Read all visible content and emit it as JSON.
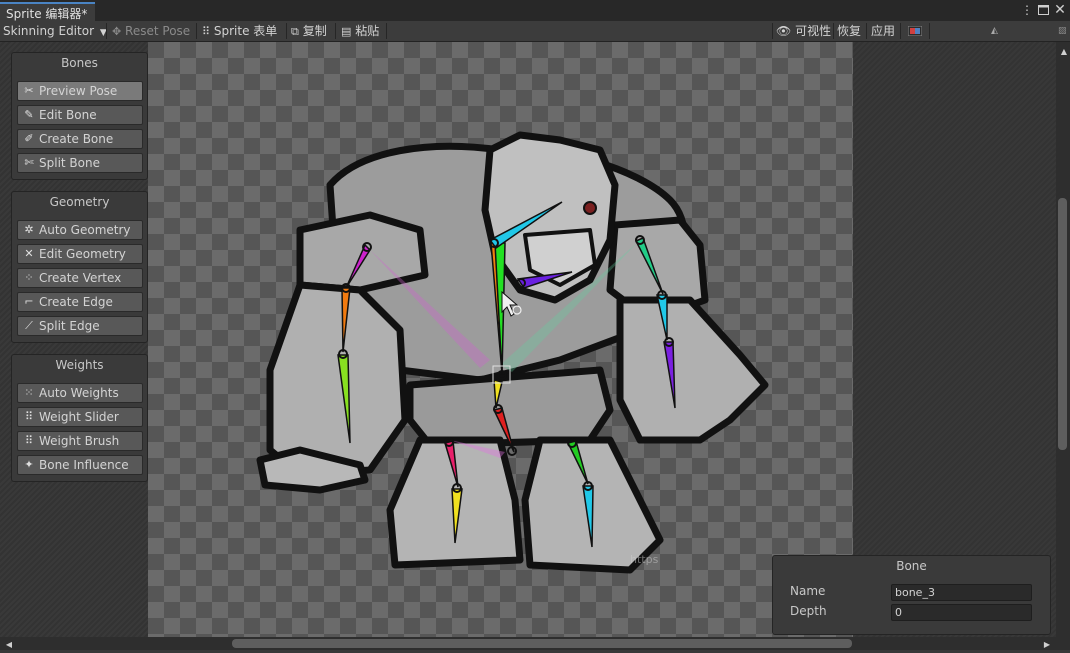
{
  "window": {
    "tab_title": "Sprite 编辑器*"
  },
  "toolbar": {
    "mode": "Skinning Editor",
    "reset_pose": "Reset Pose",
    "sprite_sheet": "Sprite 表单",
    "copy": "复制",
    "paste": "粘贴",
    "visibility": "可视性",
    "revert": "恢复",
    "apply": "应用"
  },
  "bones_panel": {
    "title": "Bones",
    "buttons": [
      {
        "label": "Preview Pose",
        "icon": "preview-pose-icon",
        "active": true
      },
      {
        "label": "Edit Bone",
        "icon": "edit-bone-icon"
      },
      {
        "label": "Create Bone",
        "icon": "create-bone-icon"
      },
      {
        "label": "Split Bone",
        "icon": "split-bone-icon"
      }
    ]
  },
  "geometry_panel": {
    "title": "Geometry",
    "buttons": [
      {
        "label": "Auto Geometry",
        "icon": "auto-geometry-icon"
      },
      {
        "label": "Edit Geometry",
        "icon": "edit-geometry-icon"
      },
      {
        "label": "Create Vertex",
        "icon": "create-vertex-icon"
      },
      {
        "label": "Create Edge",
        "icon": "create-edge-icon"
      },
      {
        "label": "Split Edge",
        "icon": "split-edge-icon"
      }
    ]
  },
  "weights_panel": {
    "title": "Weights",
    "buttons": [
      {
        "label": "Auto Weights",
        "icon": "auto-weights-icon"
      },
      {
        "label": "Weight Slider",
        "icon": "weight-slider-icon"
      },
      {
        "label": "Weight Brush",
        "icon": "weight-brush-icon"
      },
      {
        "label": "Bone Influence",
        "icon": "bone-influence-icon"
      }
    ]
  },
  "bone_inspector": {
    "title": "Bone",
    "name_label": "Name",
    "name_value": "bone_3",
    "depth_label": "Depth",
    "depth_value": "0"
  },
  "canvas": {
    "watermark": "https"
  },
  "colors": {
    "accent": "#4a84c4",
    "panel": "#3a3a3a",
    "button": "#585858",
    "active_button": "#7a7a7a"
  }
}
